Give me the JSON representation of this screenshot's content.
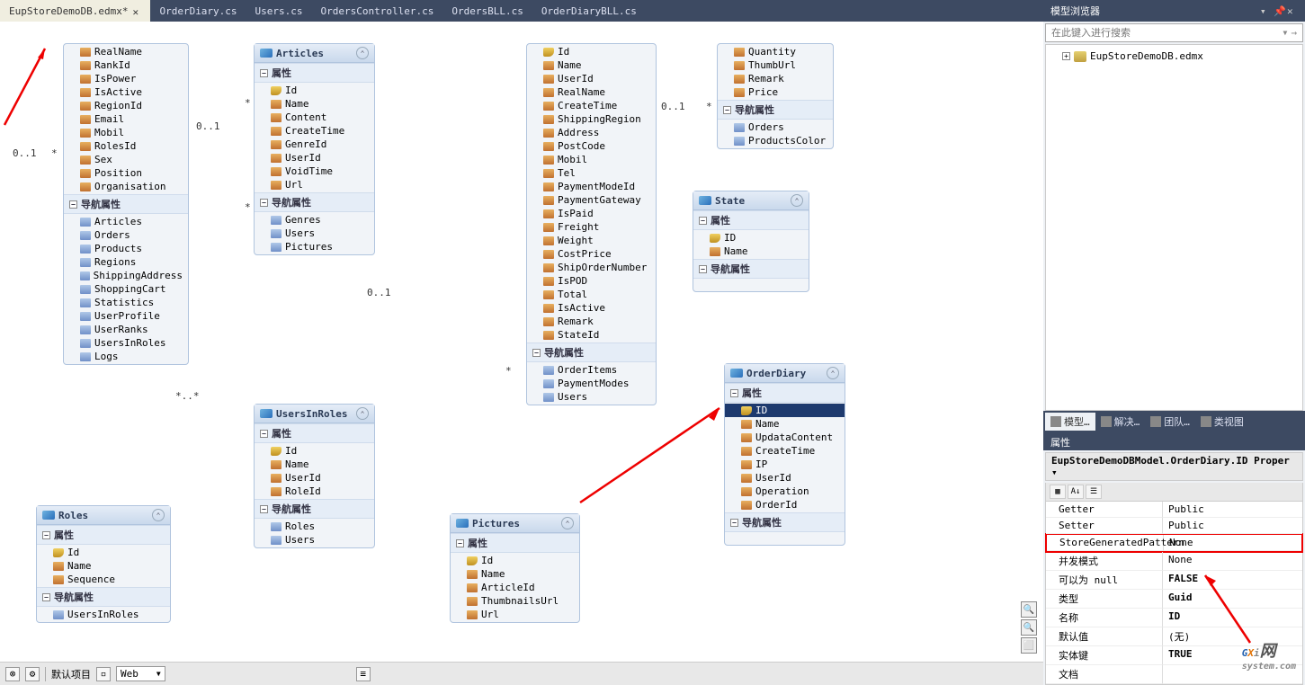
{
  "tabs": [
    {
      "label": "EupStoreDemoDB.edmx*",
      "active": true
    },
    {
      "label": "OrderDiary.cs"
    },
    {
      "label": "Users.cs"
    },
    {
      "label": "OrdersController.cs"
    },
    {
      "label": "OrdersBLL.cs"
    },
    {
      "label": "OrderDiaryBLL.cs"
    }
  ],
  "sections": {
    "props": "属性",
    "nav": "导航属性"
  },
  "rel": {
    "zeroone": "0..1",
    "star": "*"
  },
  "entities": {
    "topLeft": {
      "props": [
        "RealName",
        "RankId",
        "IsPower",
        "IsActive",
        "RegionId",
        "Email",
        "Mobil",
        "RolesId",
        "Sex",
        "Position",
        "Organisation"
      ],
      "navs": [
        "Articles",
        "Orders",
        "Products",
        "Regions",
        "ShippingAddress",
        "ShoppingCart",
        "Statistics",
        "UserProfile",
        "UserRanks",
        "UsersInRoles",
        "Logs"
      ]
    },
    "articles": {
      "title": "Articles",
      "props": [
        "Id",
        "Name",
        "Content",
        "CreateTime",
        "GenreId",
        "UserId",
        "VoidTime",
        "Url"
      ],
      "navs": [
        "Genres",
        "Users",
        "Pictures"
      ]
    },
    "usersInRoles": {
      "title": "UsersInRoles",
      "props": [
        "Id",
        "Name",
        "UserId",
        "RoleId"
      ],
      "navs": [
        "Roles",
        "Users"
      ]
    },
    "roles": {
      "title": "Roles",
      "props": [
        "Id",
        "Name",
        "Sequence"
      ],
      "navs": [
        "UsersInRoles"
      ]
    },
    "pictures": {
      "title": "Pictures",
      "props": [
        "Id",
        "Name",
        "ArticleId",
        "ThumbnailsUrl",
        "Url"
      ]
    },
    "bigMiddle": {
      "props": [
        "Id",
        "Name",
        "UserId",
        "RealName",
        "CreateTime",
        "ShippingRegion",
        "Address",
        "PostCode",
        "Mobil",
        "Tel",
        "PaymentModeId",
        "PaymentGateway",
        "IsPaid",
        "Freight",
        "Weight",
        "CostPrice",
        "ShipOrderNumber",
        "IsPOD",
        "Total",
        "IsActive",
        "Remark",
        "StateId"
      ],
      "navs": [
        "OrderItems",
        "PaymentModes",
        "Users"
      ]
    },
    "topRight": {
      "props": [
        "Quantity",
        "ThumbUrl",
        "Remark",
        "Price"
      ],
      "navs": [
        "Orders",
        "ProductsColor"
      ]
    },
    "state": {
      "title": "State",
      "props": [
        "ID",
        "Name"
      ],
      "navs": []
    },
    "orderDiary": {
      "title": "OrderDiary",
      "props": [
        "ID",
        "Name",
        "UpdataContent",
        "CreateTime",
        "IP",
        "UserId",
        "Operation",
        "OrderId"
      ],
      "selected": 0,
      "navs": []
    }
  },
  "modelBrowser": {
    "title": "模型浏览器",
    "searchPlaceholder": "在此键入进行搜索",
    "rootItem": "EupStoreDemoDB.edmx"
  },
  "panelTabs": [
    {
      "label": "模型…",
      "active": true
    },
    {
      "label": "解决…"
    },
    {
      "label": "团队…"
    },
    {
      "label": "类视图"
    }
  ],
  "propsPanel": {
    "title": "属性",
    "description": "EupStoreDemoDBModel.OrderDiary.ID Proper",
    "rows": [
      {
        "name": "Getter",
        "value": "Public"
      },
      {
        "name": "Setter",
        "value": "Public"
      },
      {
        "name": "StoreGeneratedPattern",
        "value": "None",
        "highlight": true
      },
      {
        "name": "并发模式",
        "value": "None"
      },
      {
        "name": "可以为 null",
        "value": "FALSE",
        "bold": true
      },
      {
        "name": "类型",
        "value": "Guid",
        "bold": true
      },
      {
        "name": "名称",
        "value": "ID",
        "bold": true
      },
      {
        "name": "默认值",
        "value": "(无)"
      },
      {
        "name": "实体键",
        "value": "TRUE",
        "bold": true
      },
      {
        "name": "文档",
        "value": ""
      }
    ]
  },
  "statusBar": {
    "label": "默认项目",
    "combo": "Web"
  },
  "watermark": {
    "brand": "GXi",
    "suffix": "网",
    "sub": "system.com"
  }
}
